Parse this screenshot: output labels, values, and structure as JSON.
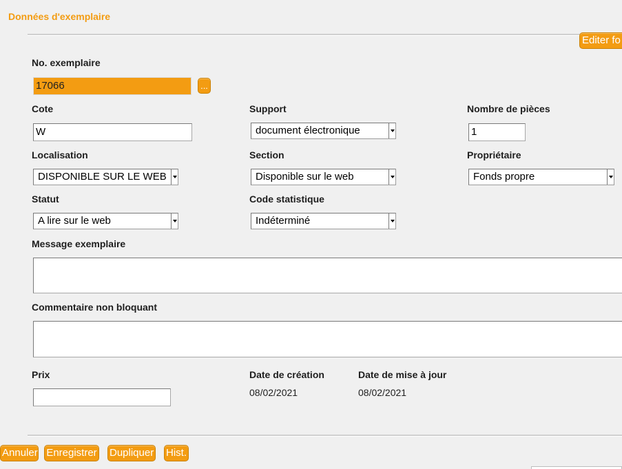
{
  "section_title": "Données d'exemplaire",
  "edit_button": "Editer fo",
  "fields": {
    "no_exemplaire": {
      "label": "No. exemplaire",
      "value": "17066",
      "browse_button": "..."
    },
    "cote": {
      "label": "Cote",
      "value": "W"
    },
    "support": {
      "label": "Support",
      "value": "document électronique"
    },
    "nombre_pieces": {
      "label": "Nombre de pièces",
      "value": "1"
    },
    "localisation": {
      "label": "Localisation",
      "value": "DISPONIBLE SUR LE WEB"
    },
    "section": {
      "label": "Section",
      "value": "Disponible sur le web"
    },
    "proprietaire": {
      "label": "Propriétaire",
      "value": "Fonds propre"
    },
    "statut": {
      "label": "Statut",
      "value": "A lire sur le web"
    },
    "code_statistique": {
      "label": "Code statistique",
      "value": "Indéterminé"
    },
    "message_exemplaire": {
      "label": "Message exemplaire",
      "value": ""
    },
    "commentaire": {
      "label": "Commentaire non bloquant",
      "value": ""
    },
    "prix": {
      "label": "Prix",
      "value": ""
    },
    "date_creation": {
      "label": "Date de création",
      "value": "08/02/2021"
    },
    "date_maj": {
      "label": "Date de mise à jour",
      "value": "08/02/2021"
    }
  },
  "actions": {
    "annuler": "Annuler",
    "enregistrer": "Enregistrer",
    "dupliquer": "Dupliquer",
    "hist": "Hist."
  },
  "colors": {
    "accent": "#f39c12",
    "background": "#f0f0f0"
  }
}
